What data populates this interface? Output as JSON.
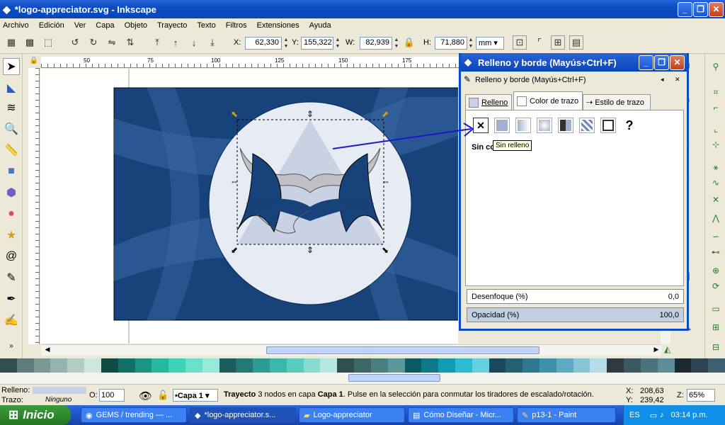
{
  "window": {
    "title": "*logo-appreciator.svg - Inkscape"
  },
  "menu": [
    "Archivo",
    "Edición",
    "Ver",
    "Capa",
    "Objeto",
    "Trayecto",
    "Texto",
    "Filtros",
    "Extensiones",
    "Ayuda"
  ],
  "coords": {
    "x_label": "X:",
    "x": "62,330",
    "y_label": "Y:",
    "y": "155,322",
    "w_label": "W:",
    "w": "82,939",
    "h_label": "H:",
    "h": "71,880",
    "unit": "mm"
  },
  "ruler": {
    "t1": "50",
    "t2": "75",
    "t3": "100",
    "t4": "125",
    "t5": "150",
    "t6": "175"
  },
  "dialog": {
    "title": "Relleno y borde (Mayús+Ctrl+F)",
    "subtitle": "Relleno y borde (Mayús+Ctrl+F)",
    "tabs": [
      "Relleno",
      "Color de trazo",
      "Estilo de trazo"
    ],
    "none_label": "Sin co",
    "tooltip": "Sin relleno",
    "blur_label": "Desenfoque (%)",
    "blur_value": "0,0",
    "opacity_label": "Opacidad (%)",
    "opacity_value": "100,0"
  },
  "status": {
    "fill_label": "Relleno:",
    "stroke_label": "Trazo:",
    "stroke_value": "Ninguno",
    "opacity_label": "O:",
    "opacity_value": "100",
    "layer": "•Capa 1",
    "msg_bold": "Trayecto",
    "msg_rest": "3 nodos en capa ",
    "msg_layer": "Capa 1",
    ". Pulse en la selección para conmutar los tiradores de escalado/rotación.": "",
    "message": ". Pulse en la selección para conmutar los tiradores de escalado/rotación.",
    "cx_label": "X:",
    "cx": "208,63",
    "cy_label": "Y:",
    "cy": "239,42",
    "zoom_label": "Z:",
    "zoom": "65%"
  },
  "taskbar": {
    "start": "Inicio",
    "tasks": [
      "GEMS / trending — ...",
      "*logo-appreciator.s...",
      "Logo-appreciator",
      "Cómo Diseñar - Micr...",
      "p13-1 - Paint"
    ],
    "lang": "ES",
    "time": "03:14 p.m."
  },
  "palette": [
    "#2f4f4f",
    "#5e7d7a",
    "#7a9995",
    "#96b4ae",
    "#b2cdc6",
    "#cfe6df",
    "#0f4b45",
    "#137064",
    "#1a9483",
    "#27b8a0",
    "#3ed2b6",
    "#6ae0c8",
    "#95ebd9",
    "#1c5c5a",
    "#237a74",
    "#2c9c92",
    "#3ab8ac",
    "#5accbf",
    "#86dcd1",
    "#b2eae3",
    "#2f4f4f",
    "#3d6666",
    "#4b7e7e",
    "#5c9898",
    "#0a5a66",
    "#0d7a8c",
    "#109db2",
    "#2dbbd0",
    "#66cfe0",
    "#1a4a5a",
    "#245f72",
    "#2f7790",
    "#3e92ad",
    "#5fabc4",
    "#8ac4d7",
    "#b7dde9",
    "#2e3a3e",
    "#3d5960",
    "#4b737c",
    "#5d8d98",
    "#1c2a30",
    "#2d4450",
    "#3e6070"
  ]
}
